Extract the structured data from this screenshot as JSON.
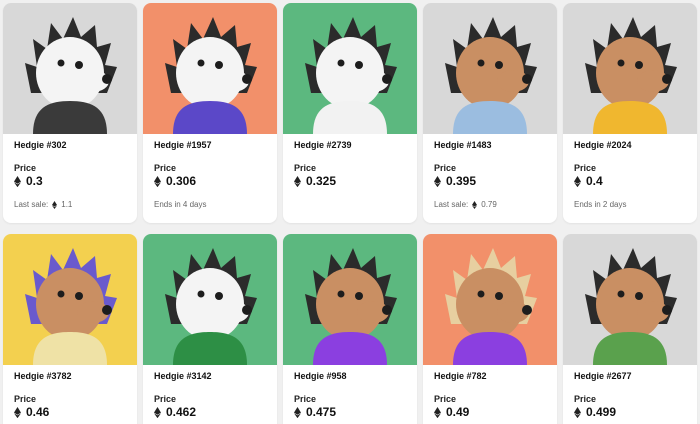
{
  "price_label": "Price",
  "last_sale_label": "Last sale:",
  "cards": [
    {
      "name": "Hedgie #302",
      "price": "0.3",
      "meta_type": "last_sale",
      "meta_value": "1.1",
      "bg": "#d8d8d8",
      "accent": "#3a3a3a"
    },
    {
      "name": "Hedgie #1957",
      "price": "0.306",
      "meta_type": "ends",
      "meta_value": "Ends in 4 days",
      "bg": "#f2906a",
      "accent": "#5b48c8"
    },
    {
      "name": "Hedgie #2739",
      "price": "0.325",
      "meta_type": "none",
      "meta_value": "",
      "bg": "#5cb87f",
      "accent": "#f2f2f2"
    },
    {
      "name": "Hedgie #1483",
      "price": "0.395",
      "meta_type": "last_sale",
      "meta_value": "0.79",
      "bg": "#d8d8d8",
      "accent": "#9bbde0"
    },
    {
      "name": "Hedgie #2024",
      "price": "0.4",
      "meta_type": "ends",
      "meta_value": "Ends in 2 days",
      "bg": "#d8d8d8",
      "accent": "#f0b72f"
    },
    {
      "name": "Hedgie #3782",
      "price": "0.46",
      "meta_type": "none",
      "meta_value": "",
      "bg": "#f3d04f",
      "accent": "#efe2a6"
    },
    {
      "name": "Hedgie #3142",
      "price": "0.462",
      "meta_type": "none",
      "meta_value": "",
      "bg": "#5cb87f",
      "accent": "#2d8f45"
    },
    {
      "name": "Hedgie #958",
      "price": "0.475",
      "meta_type": "none",
      "meta_value": "",
      "bg": "#5cb87f",
      "accent": "#8b3fe0"
    },
    {
      "name": "Hedgie #782",
      "price": "0.49",
      "meta_type": "none",
      "meta_value": "",
      "bg": "#f2906a",
      "accent": "#8b3fe0"
    },
    {
      "name": "Hedgie #2677",
      "price": "0.499",
      "meta_type": "none",
      "meta_value": "",
      "bg": "#d8d8d8",
      "accent": "#5aa14d"
    }
  ]
}
